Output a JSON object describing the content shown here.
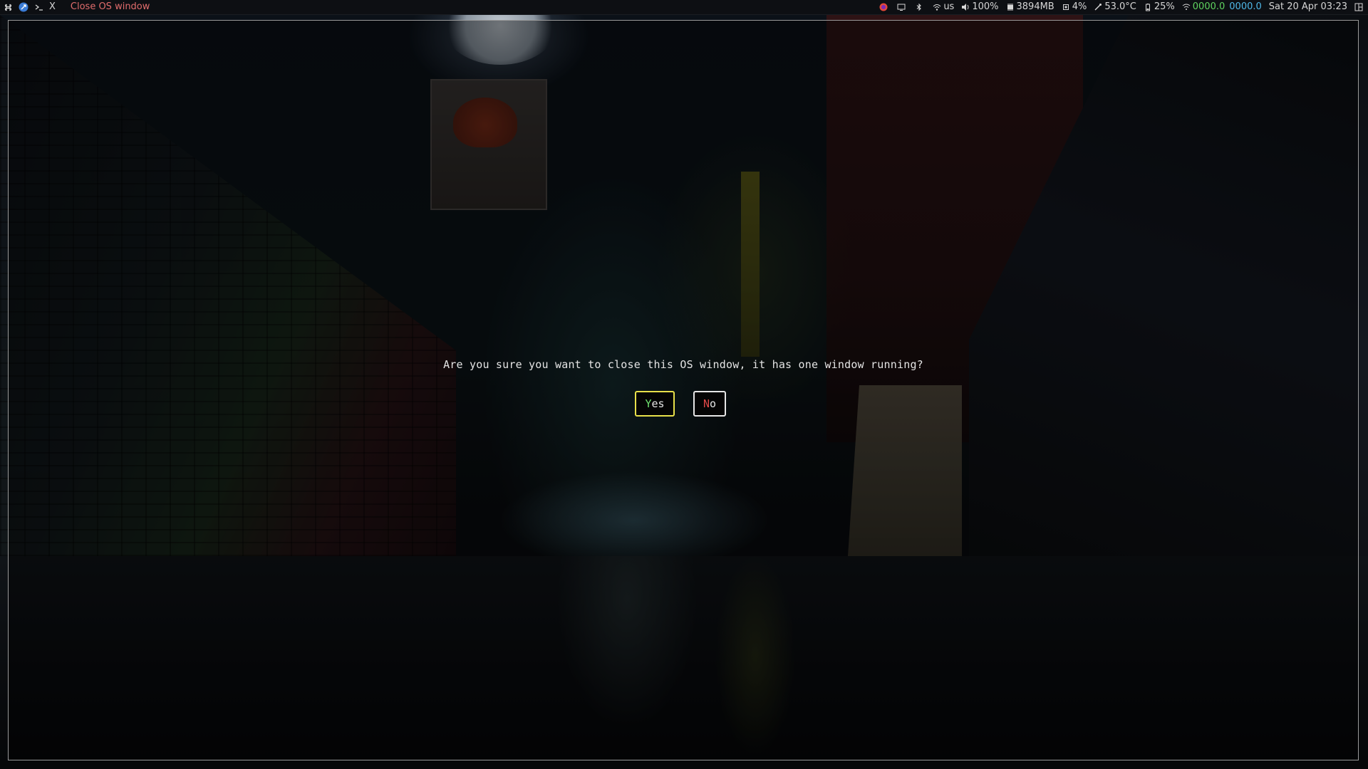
{
  "topbar": {
    "left_icons": [
      "command-icon",
      "browser-icon",
      "terminal-icon"
    ],
    "window_close_glyph": "X",
    "window_title": "Close OS window",
    "right": {
      "keyboard_layout": "us",
      "volume": "100%",
      "memory": "3894MB",
      "cpu": "4%",
      "temperature": "53.0°C",
      "battery": "25%",
      "net_up": "0000.0",
      "net_down": "0000.0",
      "datetime": "Sat 20 Apr 03:23"
    }
  },
  "dialog": {
    "message": "Are you sure you want to close this OS window, it has one window running?",
    "yes_hotkey": "Y",
    "yes_rest": "es",
    "no_hotkey": "N",
    "no_rest": "o"
  },
  "colors": {
    "title": "#e06c6c",
    "yes_border": "#e8e04a",
    "yes_hotkey": "#6ee06e",
    "no_hotkey": "#e04848",
    "net_up": "#5fd35f",
    "net_down": "#4fb8e8"
  }
}
